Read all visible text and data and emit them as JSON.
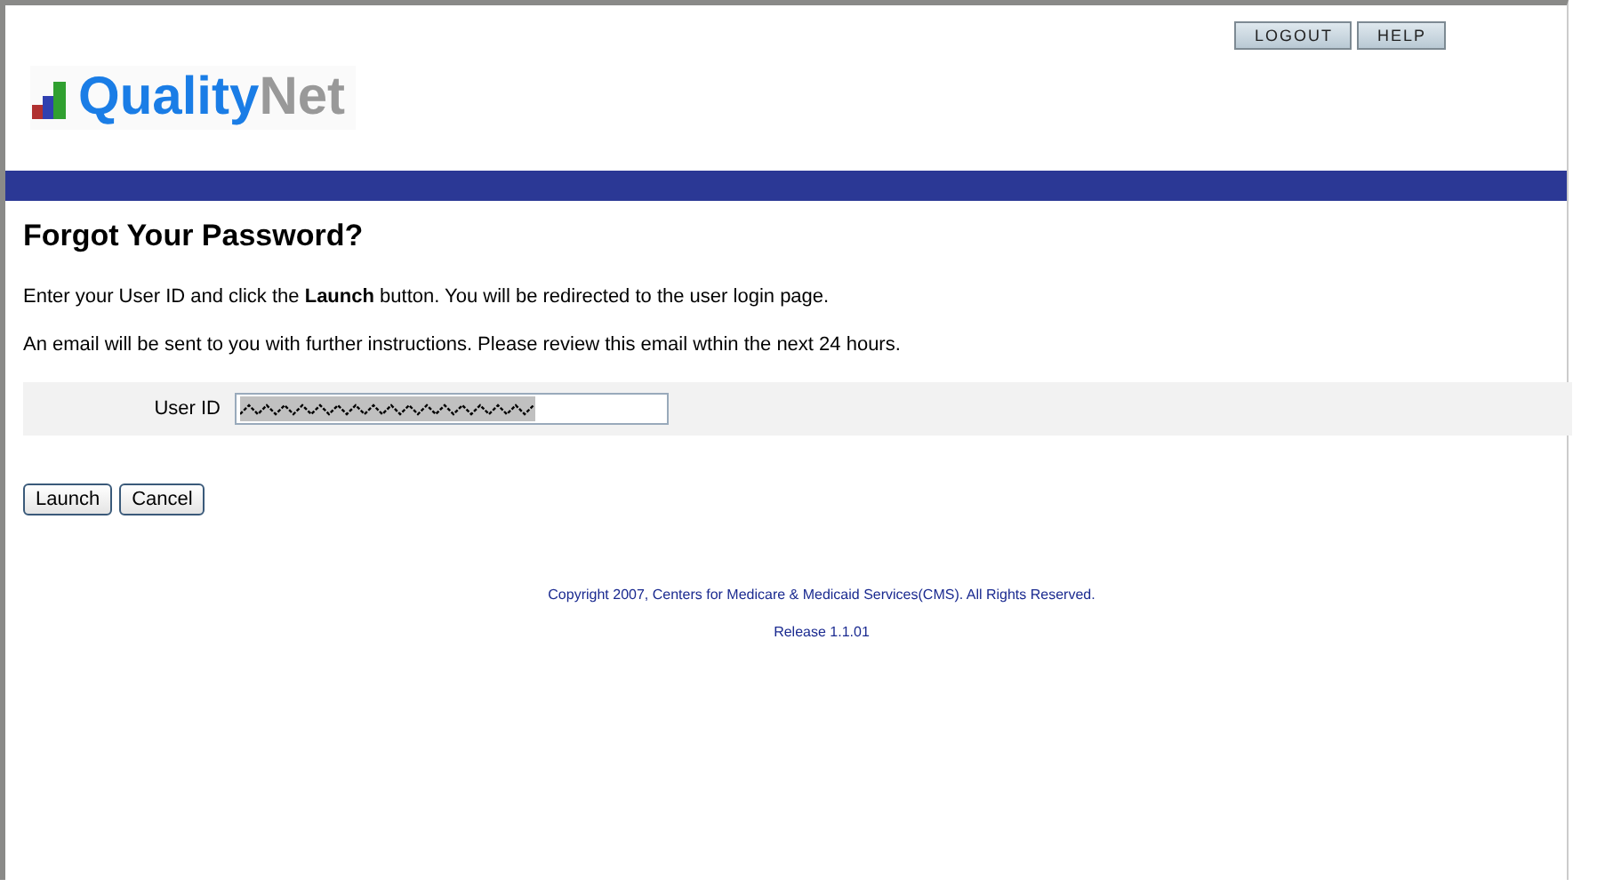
{
  "header": {
    "logo": {
      "primary": "Quality",
      "secondary": "Net"
    },
    "buttons": [
      "LOGOUT",
      "HELP"
    ]
  },
  "page_title": "Forgot Your Password?",
  "instructions": [
    "Enter your User ID and click the **Launch** button. You will be redirected to the user login page.",
    "An email will be sent to you with further instructions. Please review this email wthin the next 24 hours."
  ],
  "form": {
    "label": "User ID",
    "value_redacted": true
  },
  "buttons": [
    "Launch",
    "Cancel"
  ],
  "footer": {
    "copyright": "Copyright 2007, Centers for Medicare & Medicaid Services(CMS). All Rights Reserved.",
    "release": "Release 1.1.01"
  }
}
